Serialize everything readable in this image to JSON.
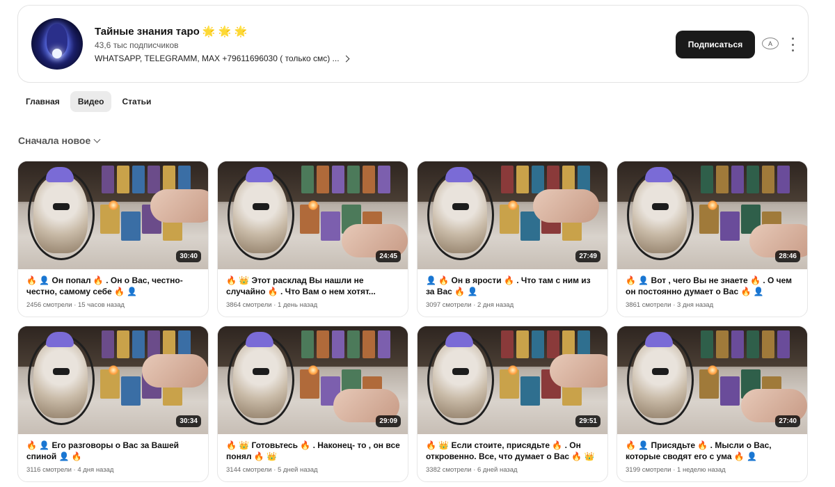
{
  "channel": {
    "name": "Тайные знания таро",
    "name_emoji": "🌟 🌟 🌟",
    "subscribers": "43,6 тыс подписчиков",
    "about": "WHATSAPP, TELEGRAMM, MAX +79611696030 ( только смс) ...",
    "subscribe_label": "Подписаться",
    "tts_label": "A",
    "icons": {
      "avatar": "avatar",
      "more": "more-vertical-icon",
      "tts": "text-to-speech-icon",
      "about_chevron": "chevron-right-icon"
    }
  },
  "tabs": [
    {
      "label": "Главная",
      "active": false
    },
    {
      "label": "Видео",
      "active": true
    },
    {
      "label": "Статьи",
      "active": false
    }
  ],
  "sort": {
    "label": "Сначала новое",
    "icon": "chevron-down-icon"
  },
  "videos": [
    {
      "title": "🔥 👤 Он попал 🔥 . Он о Вас, честно-честно, самому себе 🔥 👤",
      "duration": "30:40",
      "meta": "2456 смотрели · 15 часов назад"
    },
    {
      "title": "🔥 👑 Этот расклад Вы нашли не случайно 🔥 . Что Вам о нем хотят...",
      "duration": "24:45",
      "meta": "3864 смотрели · 1 день назад"
    },
    {
      "title": "👤 🔥 Он в ярости 🔥 . Что там с ним из за Вас 🔥 👤",
      "duration": "27:49",
      "meta": "3097 смотрели · 2 дня назад"
    },
    {
      "title": "🔥 👤 Вот , чего Вы не знаете 🔥 . О чем он постоянно думает о Вас 🔥 👤",
      "duration": "28:46",
      "meta": "3861 смотрели · 3 дня назад"
    },
    {
      "title": "🔥 👤 Его разговоры о Вас за Вашей спиной 👤 🔥",
      "duration": "30:34",
      "meta": "3116 смотрели · 4 дня назад"
    },
    {
      "title": "🔥 👑 Готовьтесь 🔥 . Наконец- то , он все понял 🔥 👑",
      "duration": "29:09",
      "meta": "3144 смотрели · 5 дней назад"
    },
    {
      "title": "🔥 👑 Если стоите, присядьте 🔥 . Он откровенно. Все, что думает о Вас 🔥 👑",
      "duration": "29:51",
      "meta": "3382 смотрели · 6 дней назад"
    },
    {
      "title": "🔥 👤 Присядьте 🔥 . Мысли о Вас, которые сводят его с ума 🔥 👤",
      "duration": "27:40",
      "meta": "3199 смотрели · 1 неделю назад"
    }
  ],
  "colors": {
    "subscribe_bg": "#1a1a1a",
    "tab_active_bg": "#ebebeb",
    "duration_bg": "#000000"
  }
}
